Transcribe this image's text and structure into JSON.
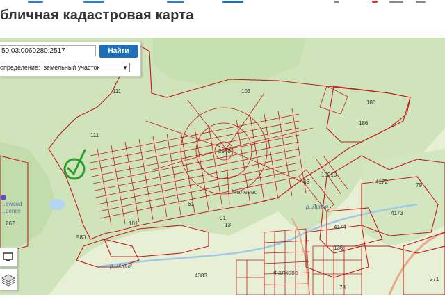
{
  "page": {
    "title": "бличная кадастровая карта"
  },
  "search": {
    "cadastral_value": "50:03:0060280:2517",
    "find_button": "Найти",
    "definition_label": "определение:",
    "definition_value": "земельный участок"
  },
  "map": {
    "settlements": [
      "Малеево",
      "Фалково"
    ],
    "rivers": [
      "р. Липня",
      "р. Липня"
    ],
    "poi": [
      "…ewood",
      "…dence"
    ],
    "parcels": [
      "111",
      "111",
      "103",
      "186",
      "186",
      "4172",
      "79",
      "4173",
      "4174",
      "136",
      "101",
      "267",
      "580",
      "271",
      "10910",
      "2940",
      "4383",
      "91",
      "13",
      "61",
      "78",
      "66"
    ]
  },
  "colors": {
    "parcel_stroke": "#c41b1b",
    "map_background": "#e7efd4",
    "forest": "#c9e1b4",
    "water": "#b3d6ee",
    "road": "#e8a98a",
    "marker": "#2e9e2e",
    "button": "#1f6fb8"
  },
  "icons": {
    "marker": "check-circle-icon",
    "layers": "layers-icon",
    "monitor": "monitor-icon",
    "dropdown": "chevron-down-icon"
  }
}
